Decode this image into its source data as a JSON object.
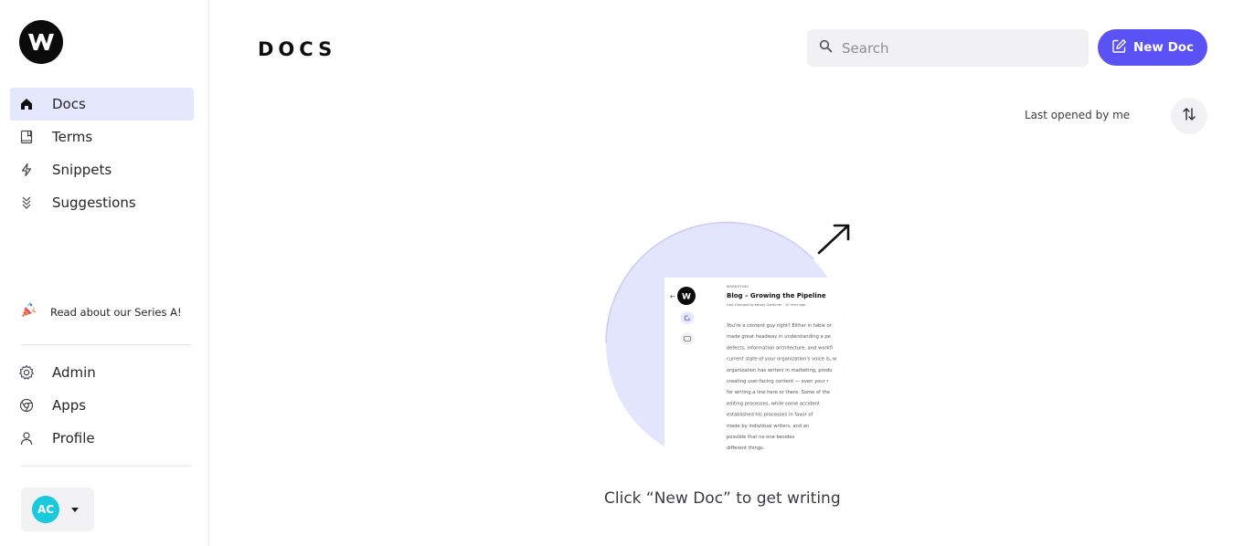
{
  "sidebar": {
    "logo_letter": "W",
    "nav_top": [
      {
        "label": "Docs",
        "icon": "home-icon",
        "active": true
      },
      {
        "label": "Terms",
        "icon": "book-icon",
        "active": false
      },
      {
        "label": "Snippets",
        "icon": "lightning-icon",
        "active": false
      },
      {
        "label": "Suggestions",
        "icon": "chevrons-down-icon",
        "active": false
      }
    ],
    "promo": {
      "label": "Read about our Series A!",
      "icon": "party-popper-icon"
    },
    "nav_bottom": [
      {
        "label": "Admin",
        "icon": "gear-icon"
      },
      {
        "label": "Apps",
        "icon": "chrome-icon"
      },
      {
        "label": "Profile",
        "icon": "person-icon"
      }
    ],
    "user": {
      "initials": "AC",
      "avatar_color": "#19c9dc"
    }
  },
  "header": {
    "title": "DOCS",
    "search_placeholder": "Search",
    "new_doc_label": "New Doc"
  },
  "sort": {
    "label": "Last opened by me"
  },
  "empty_state": {
    "text": "Click “New Doc” to get writing",
    "preview": {
      "category": "MARKETING",
      "doc_title": "Blog – Growing the Pipeline",
      "meta": "Last changed by Kelsey Gardener · 10 mins ago",
      "lines": [
        "You're a content guy right? Either in table or",
        "made great headway in understanding a pe",
        "defects, information architecture, and workfl",
        "current state of your organization's voice is, w",
        "organization has writers in marketing, produ",
        "creating user-facing content — even your r",
        "for writing a line here or there. Some of the",
        "editing processes, while some accident",
        "established his processes in favor of",
        "made by individual writers, and an",
        "possible that no one besides",
        "different things."
      ]
    }
  },
  "colors": {
    "accent": "#5a52f5",
    "active_nav_bg": "#e5e7fd",
    "illustration_circle": "#e3e5fd"
  }
}
